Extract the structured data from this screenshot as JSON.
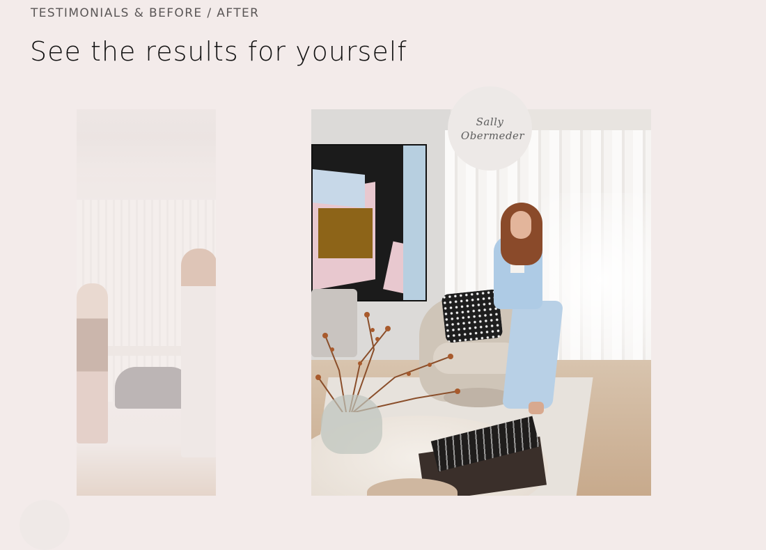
{
  "section": {
    "eyebrow": "TESTIMONIALS & BEFORE / AFTER",
    "headline": "See the results for yourself"
  },
  "testimonial": {
    "signature_line1": "Sally",
    "signature_line2": "Obermeder"
  },
  "carousel": {
    "prev_icon": "chevron-left-icon"
  },
  "colors": {
    "background": "#f3ebea",
    "badge": "#ede9e7",
    "text": "#121212",
    "eyebrow": "#5a5656"
  }
}
